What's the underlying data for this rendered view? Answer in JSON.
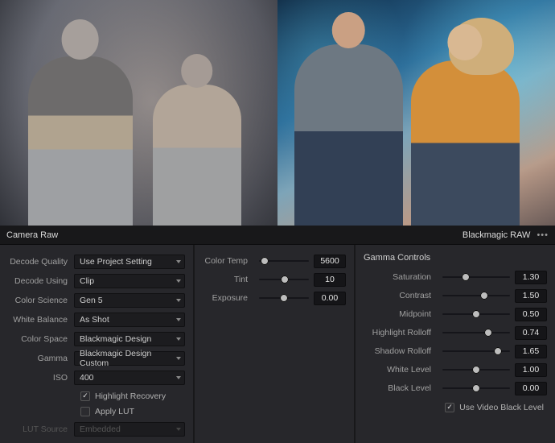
{
  "header": {
    "left_title": "Camera Raw",
    "right_title": "Blackmagic RAW",
    "menu_icon": "•••"
  },
  "left_panel": {
    "rows": [
      {
        "label": "Decode Quality",
        "value": "Use Project Setting"
      },
      {
        "label": "Decode Using",
        "value": "Clip"
      },
      {
        "label": "Color Science",
        "value": "Gen 5"
      },
      {
        "label": "White Balance",
        "value": "As Shot"
      },
      {
        "label": "Color Space",
        "value": "Blackmagic Design"
      },
      {
        "label": "Gamma",
        "value": "Blackmagic Design Custom"
      },
      {
        "label": "ISO",
        "value": "400"
      }
    ],
    "highlight_recovery": {
      "label": "Highlight Recovery",
      "checked": true
    },
    "apply_lut": {
      "label": "Apply LUT",
      "checked": false
    },
    "lut_source": {
      "label": "LUT Source",
      "value": "Embedded",
      "disabled": true
    }
  },
  "mid_panel": {
    "sliders": [
      {
        "label": "Color Temp",
        "value": "5600",
        "pos": 0.12
      },
      {
        "label": "Tint",
        "value": "10",
        "pos": 0.52
      },
      {
        "label": "Exposure",
        "value": "0.00",
        "pos": 0.5
      }
    ]
  },
  "right_panel": {
    "title": "Gamma Controls",
    "sliders": [
      {
        "label": "Saturation",
        "value": "1.30",
        "pos": 0.34
      },
      {
        "label": "Contrast",
        "value": "1.50",
        "pos": 0.62
      },
      {
        "label": "Midpoint",
        "value": "0.50",
        "pos": 0.5
      },
      {
        "label": "Highlight Rolloff",
        "value": "0.74",
        "pos": 0.68
      },
      {
        "label": "Shadow Rolloff",
        "value": "1.65",
        "pos": 0.82
      },
      {
        "label": "White Level",
        "value": "1.00",
        "pos": 0.5
      },
      {
        "label": "Black Level",
        "value": "0.00",
        "pos": 0.5
      }
    ],
    "video_black": {
      "label": "Use Video Black Level",
      "checked": true
    }
  }
}
